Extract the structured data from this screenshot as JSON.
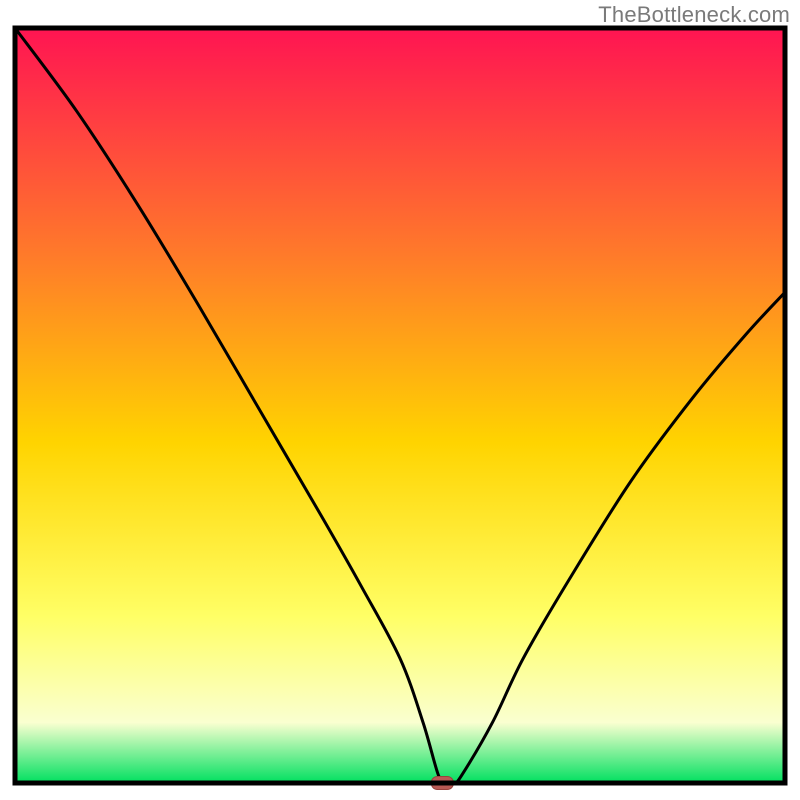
{
  "watermark": "TheBottleneck.com",
  "colors": {
    "frame": "#000000",
    "curve": "#000000",
    "marker_fill": "#b85a54",
    "marker_stroke": "#9a423c",
    "gradient_top": "#ff1452",
    "gradient_mid1": "#ff7a2a",
    "gradient_mid2": "#ffd400",
    "gradient_mid3": "#ffff66",
    "gradient_mid4": "#faffd0",
    "gradient_bottom": "#00e060"
  },
  "chart_data": {
    "type": "line",
    "title": "",
    "xlabel": "",
    "ylabel": "",
    "xlim": [
      0,
      100
    ],
    "ylim": [
      0,
      100
    ],
    "grid": false,
    "legend": false,
    "annotations": [
      {
        "kind": "marker",
        "x": 55.5,
        "y": 0,
        "shape": "rounded-pill"
      }
    ],
    "series": [
      {
        "name": "bottleneck-curve",
        "x": [
          0,
          8,
          16,
          24,
          32,
          40,
          45,
          50,
          53,
          55,
          56,
          57,
          58,
          62,
          66,
          72,
          80,
          88,
          95,
          100
        ],
        "values": [
          100,
          89,
          76.5,
          63,
          49,
          35,
          26,
          16.5,
          8,
          1,
          0,
          0,
          1,
          8,
          16.5,
          27,
          40,
          51,
          59.5,
          65
        ]
      }
    ]
  }
}
